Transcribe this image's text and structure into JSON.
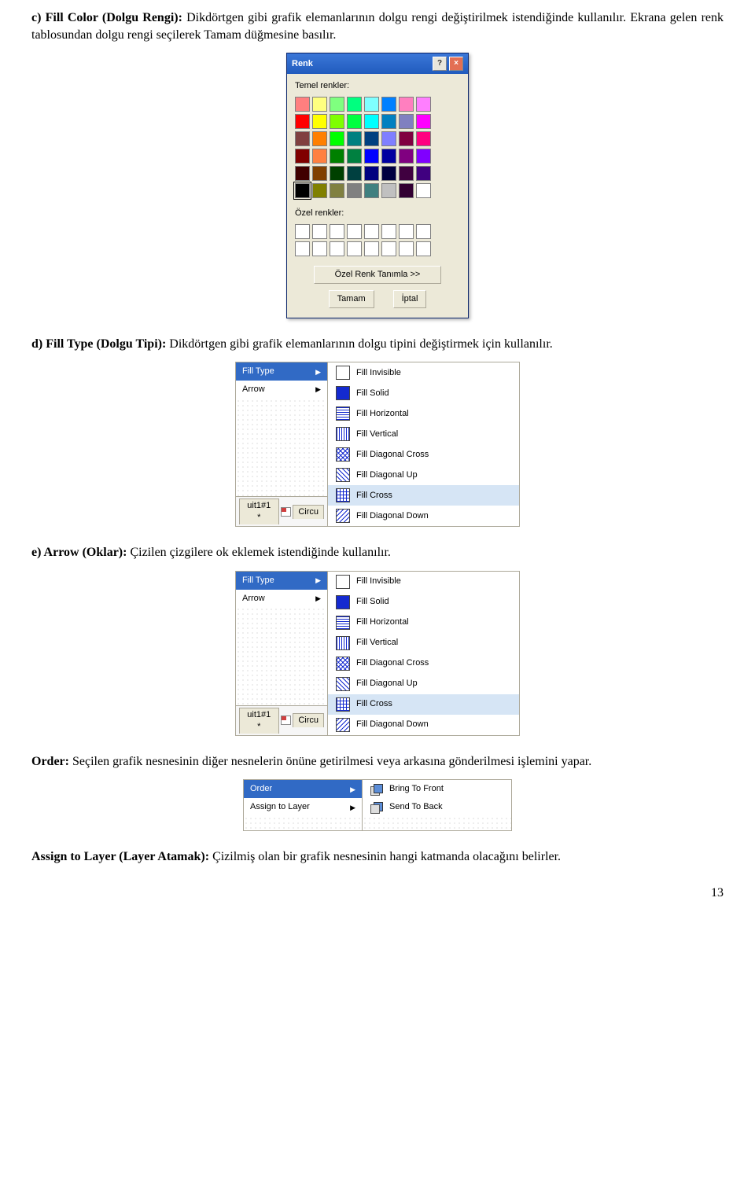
{
  "para1": {
    "head": "c) Fill Color (Dolgu Rengi):",
    "body": " Dikdörtgen gibi grafik elemanlarının dolgu rengi değiştirilmek istendiğinde kullanılır. Ekrana gelen renk tablosundan dolgu rengi seçilerek Tamam düğmesine basılır."
  },
  "color_dialog": {
    "title": "Renk",
    "basic_label": "Temel renkler:",
    "custom_label": "Özel renkler:",
    "define_btn": "Özel Renk Tanımla >>",
    "ok_btn": "Tamam",
    "cancel_btn": "İptal",
    "rows": [
      [
        "#ff7f7f",
        "#ffff7f",
        "#7fff7f",
        "#00ff7f",
        "#7fffff",
        "#0080ff",
        "#ff7fbf",
        "#ff7fff"
      ],
      [
        "#ff0000",
        "#ffff00",
        "#7fff00",
        "#00ff40",
        "#00ffff",
        "#0080c0",
        "#8080c0",
        "#ff00ff"
      ],
      [
        "#804040",
        "#ff8000",
        "#00ff00",
        "#008080",
        "#004080",
        "#7f7fff",
        "#800040",
        "#ff0080"
      ],
      [
        "#800000",
        "#ff8040",
        "#008000",
        "#008040",
        "#0000ff",
        "#0000a0",
        "#800080",
        "#8000ff"
      ],
      [
        "#400000",
        "#804000",
        "#004000",
        "#004040",
        "#000080",
        "#000040",
        "#400040",
        "#400080"
      ],
      [
        "#000000",
        "#808000",
        "#808040",
        "#808080",
        "#408080",
        "#c0c0c0",
        "#320032",
        "#ffffff"
      ]
    ]
  },
  "para2": {
    "head": "d) Fill Type (Dolgu Tipi):",
    "body": " Dikdörtgen gibi grafik elemanlarının dolgu tipini değiştirmek için kullanılır."
  },
  "menu": {
    "fill_type": "Fill Type",
    "arrow": "Arrow",
    "items": [
      "Fill Invisible",
      "Fill Solid",
      "Fill Horizontal",
      "Fill Vertical",
      "Fill Diagonal Cross",
      "Fill Diagonal Up",
      "Fill Cross",
      "Fill Diagonal Down"
    ],
    "tab1": "uit1#1 *",
    "tab2": "Circu"
  },
  "para3": {
    "head": "e) Arrow (Oklar):",
    "body": " Çizilen çizgilere ok eklemek istendiğinde kullanılır."
  },
  "para4": {
    "head": "Order:",
    "body": " Seçilen grafik nesnesinin diğer nesnelerin önüne getirilmesi veya arkasına gönderilmesi işlemini yapar."
  },
  "order_menu": {
    "order": "Order",
    "assign": "Assign to Layer",
    "front": "Bring To Front",
    "back": "Send To Back"
  },
  "para5": {
    "head": "Assign to Layer (Layer Atamak):",
    "body": " Çizilmiş olan bir grafik nesnesinin hangi katmanda olacağını belirler."
  },
  "page_number": "13"
}
